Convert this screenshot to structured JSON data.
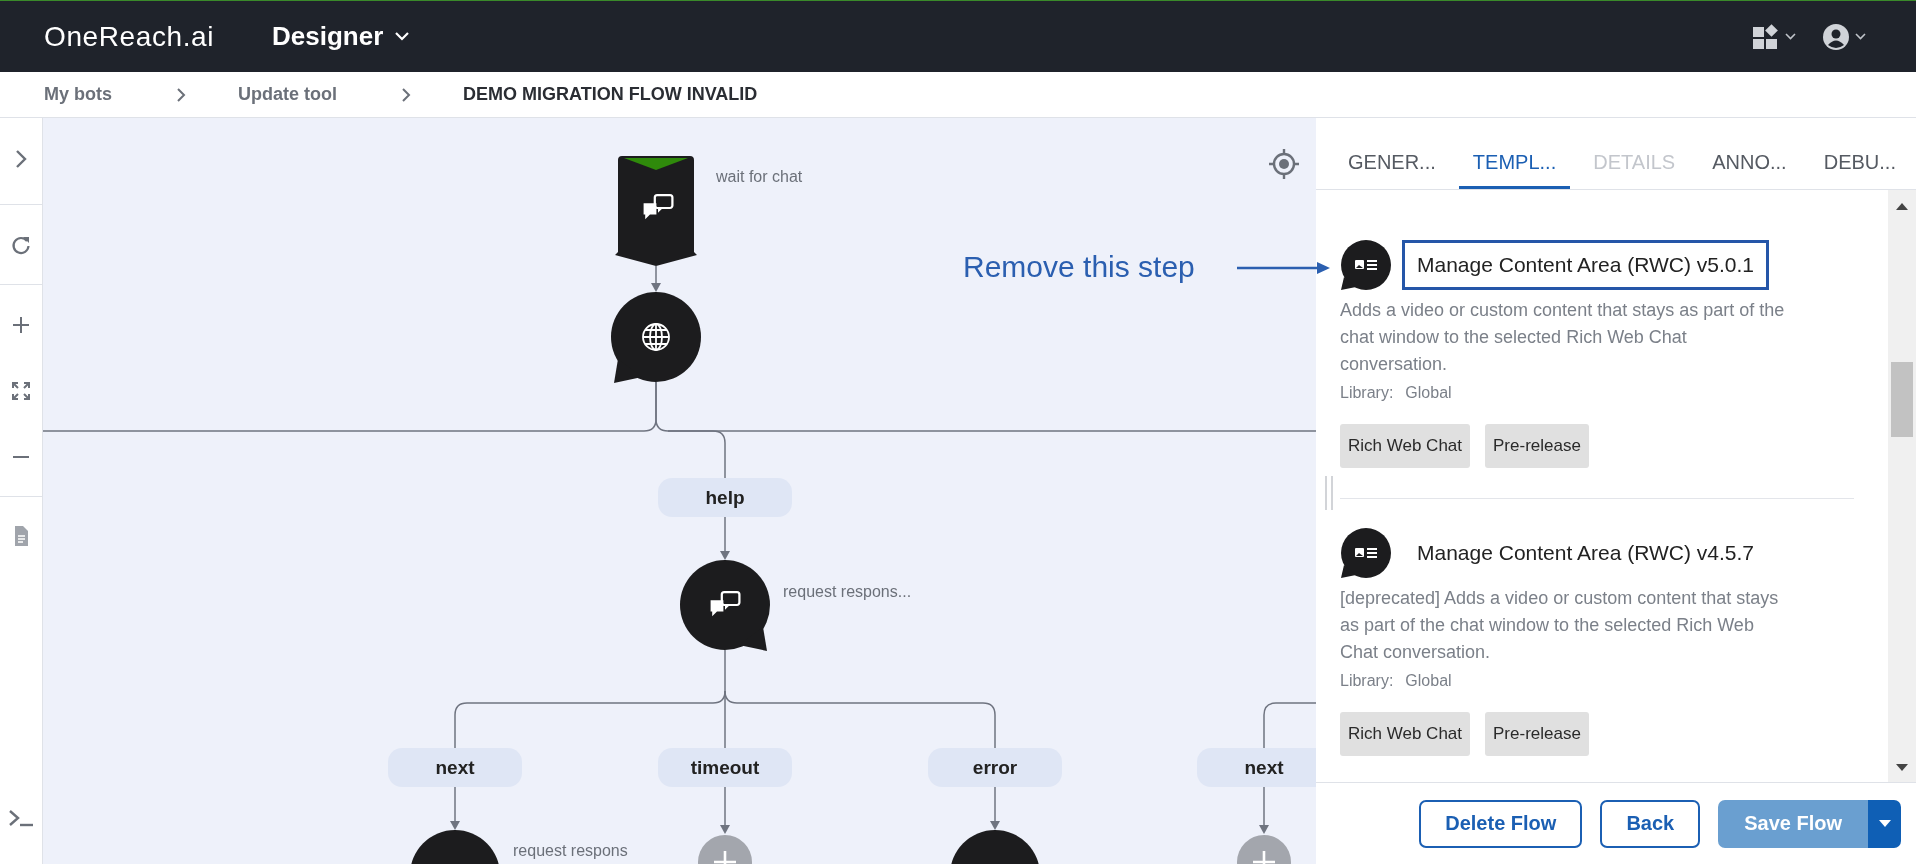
{
  "header": {
    "logo": "OneReach.ai",
    "app": "Designer"
  },
  "breadcrumb": [
    {
      "label": "My bots",
      "current": false
    },
    {
      "label": "Update tool",
      "current": false
    },
    {
      "label": "DEMO MIGRATION FLOW INVALID",
      "current": true
    }
  ],
  "canvas": {
    "nodes": [
      {
        "kind": "trigger",
        "label": "wait for chat"
      },
      {
        "kind": "step"
      },
      {
        "kind": "step",
        "label": "request respons..."
      },
      {
        "kind": "step",
        "label": "request respons"
      },
      {
        "kind": "add"
      },
      {
        "kind": "step"
      },
      {
        "kind": "add"
      }
    ],
    "branches": [
      {
        "label": "help"
      },
      {
        "label": "next"
      },
      {
        "label": "timeout"
      },
      {
        "label": "error"
      },
      {
        "label": "next"
      }
    ]
  },
  "annotation": {
    "text": "Remove this step"
  },
  "panel": {
    "tabs": [
      {
        "label": "GENER...",
        "selected": false,
        "disabled": false
      },
      {
        "label": "TEMPL...",
        "selected": true,
        "disabled": false
      },
      {
        "label": "DETAILS",
        "selected": false,
        "disabled": true
      },
      {
        "label": "ANNO...",
        "selected": false,
        "disabled": false
      },
      {
        "label": "DEBU...",
        "selected": false,
        "disabled": false
      }
    ],
    "items": [
      {
        "title": "Manage Content Area (RWC) v5.0.1",
        "highlighted": true,
        "description": "Adds a video or custom content that stays as part of the chat window to the selected Rich Web Chat conversation.",
        "library_label": "Library:",
        "library": "Global",
        "tags": [
          "Rich Web Chat",
          "Pre-release"
        ]
      },
      {
        "title": "Manage Content Area (RWC) v4.5.7",
        "highlighted": false,
        "description": "[deprecated] Adds a video or custom content that stays as part of the chat window to the selected Rich Web Chat conversation.",
        "library_label": "Library:",
        "library": "Global",
        "tags": [
          "Rich Web Chat",
          "Pre-release"
        ]
      }
    ],
    "buttons": [
      {
        "label": "Delete Flow",
        "kind": "outline"
      },
      {
        "label": "Back",
        "kind": "outline"
      },
      {
        "label": "Save Flow",
        "kind": "primary"
      }
    ]
  }
}
